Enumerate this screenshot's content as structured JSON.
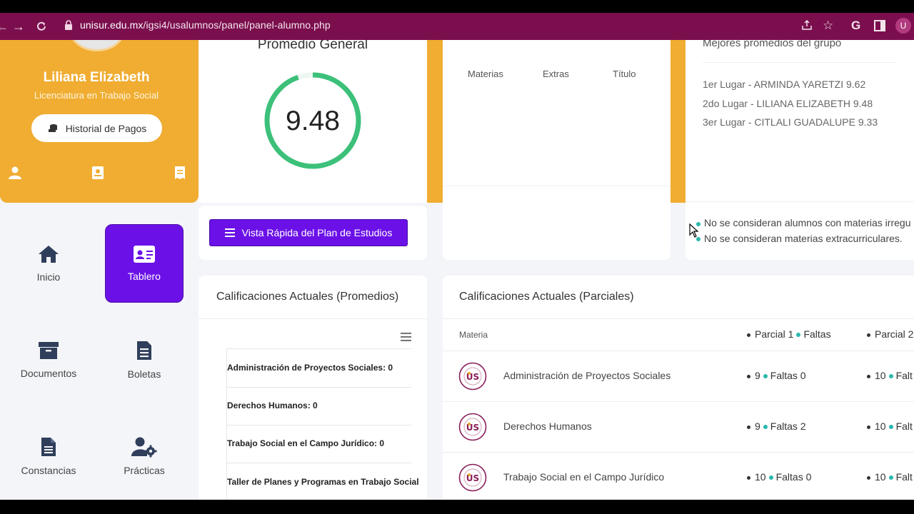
{
  "browser": {
    "url_host": "unisur.edu.mx",
    "url_path": "/igsi4/usalumnos/panel/panel-alumno.php",
    "profile_initial": "U",
    "extension_letter": "G"
  },
  "profile": {
    "name": "Liliana Elizabeth",
    "career": "Licenciatura en Trabajo Social",
    "payments_button": "Historial de Pagos"
  },
  "average": {
    "title": "Promedio General",
    "value": "9.48",
    "fraction": 0.948,
    "color": "#3cc07a"
  },
  "plan_button": "Vista Rápida del Plan de Estudios",
  "subjects_table": {
    "columns": [
      "Materias",
      "Extras",
      "Título"
    ]
  },
  "best": {
    "title": "Mejores promedios del grupo",
    "lines": [
      "1er Lugar - ARMINDA YARETZI 9.62",
      "2do Lugar - LILIANA ELIZABETH 9.48",
      "3er Lugar - CITLALI GUADALUPE 9.33"
    ],
    "notes": [
      "No se consideran alumnos con materias irregu",
      "No se consideran materias extracurriculares."
    ]
  },
  "menu": {
    "inicio": "Inicio",
    "tablero": "Tablero",
    "documentos": "Documentos",
    "boletas": "Boletas",
    "constancias": "Constancias",
    "practicas": "Prácticas"
  },
  "promedios": {
    "title": "Calificaciones Actuales (Promedios)",
    "items": [
      "Administración de Proyectos Sociales: 0",
      "Derechos Humanos: 0",
      "Trabajo Social en el Campo Jurídico: 0",
      "Taller de Planes y Programas en Trabajo Social"
    ]
  },
  "parciales": {
    "title": "Calificaciones Actuales (Parciales)",
    "col_materia": "Materia",
    "col_parcial1": "Parcial 1",
    "col_faltas": "Faltas",
    "col_parcial2": "Parcial 2",
    "rows": [
      {
        "subject": "Administración de Proyectos Sociales",
        "p1": "9",
        "faltas": "Faltas 0",
        "p2": "10",
        "f2": "Falt"
      },
      {
        "subject": "Derechos Humanos",
        "p1": "9",
        "faltas": "Faltas 2",
        "p2": "10",
        "f2": "Falt"
      },
      {
        "subject": "Trabajo Social en el Campo Jurídico",
        "p1": "10",
        "faltas": "Faltas 0",
        "p2": "10",
        "f2": "Falt"
      }
    ]
  },
  "colors": {
    "brand_purple": "#6b11e8",
    "orange": "#f0ad32",
    "browser_bar": "#7b0f4e",
    "teal": "#2ab7ac"
  }
}
